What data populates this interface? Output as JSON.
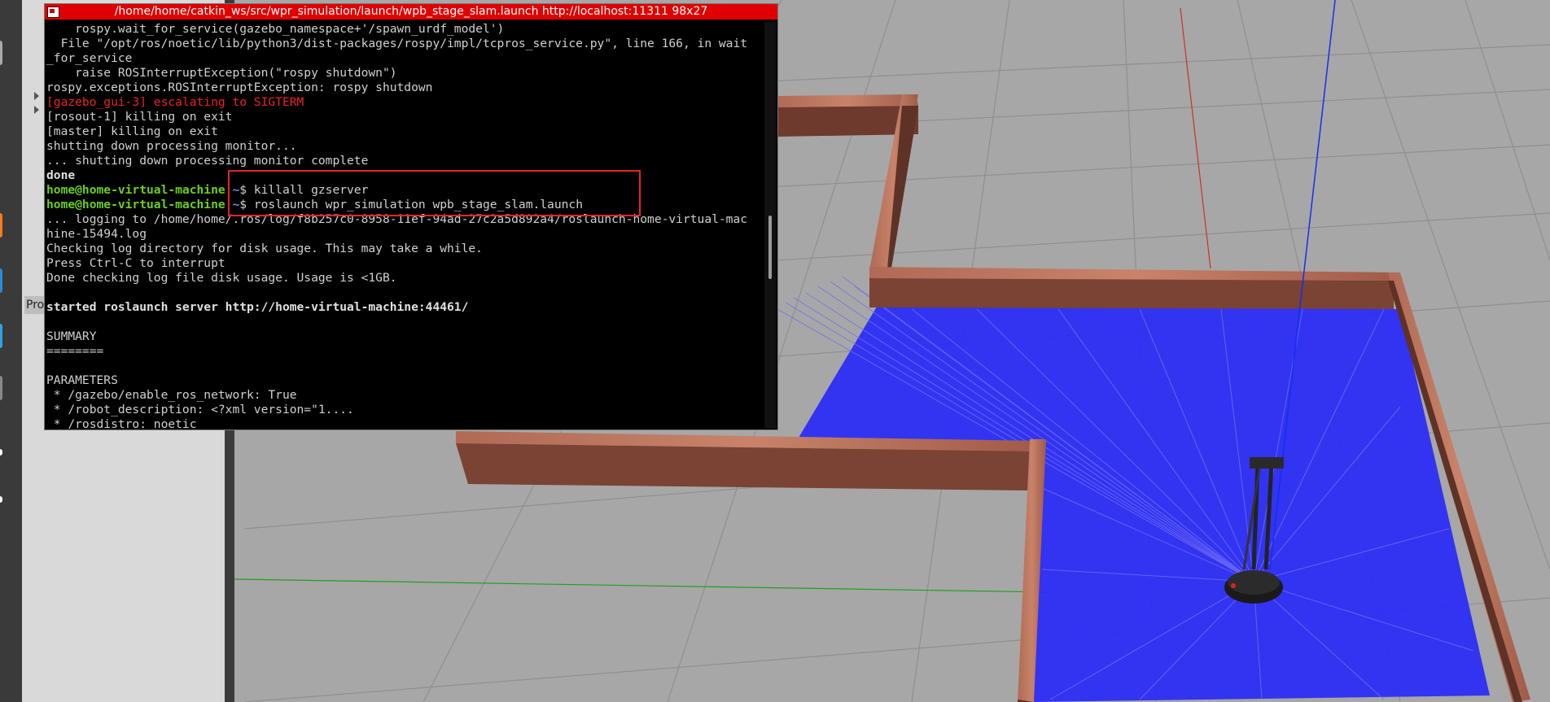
{
  "terminal": {
    "title": "/home/home/catkin_ws/src/wpr_simulation/launch/wpb_stage_slam.launch http://localhost:11311 98x27",
    "lines": [
      {
        "text": "    rospy.wait_for_service(gazebo_namespace+'/spawn_urdf_model')"
      },
      {
        "text": "  File \"/opt/ros/noetic/lib/python3/dist-packages/rospy/impl/tcpros_service.py\", line 166, in wait"
      },
      {
        "text": "_for_service"
      },
      {
        "text": "    raise ROSInterruptException(\"rospy shutdown\")"
      },
      {
        "text": "rospy.exceptions.ROSInterruptException: rospy shutdown"
      },
      {
        "text": "[gazebo_gui-3] escalating to SIGTERM",
        "style": "red"
      },
      {
        "text": "[rosout-1] killing on exit"
      },
      {
        "text": "[master] killing on exit"
      },
      {
        "text": "shutting down processing monitor..."
      },
      {
        "text": "... shutting down processing monitor complete"
      },
      {
        "text": "done",
        "style": "bold"
      },
      {
        "prompt_user": "home@home-virtual-machine",
        "prompt_path": "~",
        "command": "$ killall gzserver"
      },
      {
        "prompt_user": "home@home-virtual-machine",
        "prompt_path": "~",
        "command": "$ roslaunch wpr_simulation wpb_stage_slam.launch"
      },
      {
        "text": "... logging to /home/home/.ros/log/f8b257c0-8958-11ef-94ad-27c2a5d892a4/roslaunch-home-virtual-mac"
      },
      {
        "text": "hine-15494.log"
      },
      {
        "text": "Checking log directory for disk usage. This may take a while."
      },
      {
        "text": "Press Ctrl-C to interrupt"
      },
      {
        "text": "Done checking log file disk usage. Usage is <1GB."
      },
      {
        "text": ""
      },
      {
        "text": "started roslaunch server http://home-virtual-machine:44461/",
        "style": "bold"
      },
      {
        "text": ""
      },
      {
        "text": "SUMMARY"
      },
      {
        "text": "========"
      },
      {
        "text": ""
      },
      {
        "text": "PARAMETERS"
      },
      {
        "text": " * /gazebo/enable_ros_network: True"
      },
      {
        "text": " * /robot_description: <?xml version=\"1...."
      },
      {
        "text": " * /rosdistro: noetic"
      }
    ]
  },
  "gazebo": {
    "side_tab_label": "Pro"
  },
  "colors": {
    "terminal_title_bg": "#e00000",
    "prompt_user": "#6ccf1d",
    "prompt_path": "#6a8fd8",
    "error_text": "#ee2222",
    "highlight": "#e3232c",
    "laser": "#2a2aff",
    "floor": "#a6a6a6",
    "wall": "#8a4a3a"
  }
}
